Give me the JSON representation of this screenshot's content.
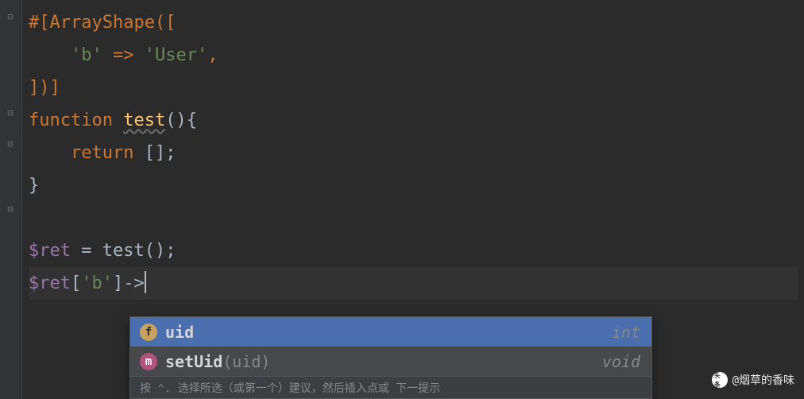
{
  "code": {
    "line1_attr": "#[",
    "line1_name": "ArrayShape",
    "line1_rest": "([",
    "line2_indent": "    ",
    "line2_key": "'b'",
    "line2_arrow": " => ",
    "line2_val": "'User'",
    "line2_comma": ",",
    "line3": "])]",
    "line4_fn": "function ",
    "line4_name": "test",
    "line4_rest": "(){",
    "line5_indent": "    ",
    "line5_return": "return ",
    "line5_arr": "[]",
    "line5_semi": ";",
    "line6": "}",
    "line7": "",
    "line8_var": "$ret",
    "line8_eq": " = ",
    "line8_call": "test()",
    "line8_semi": ";",
    "line9_var": "$ret",
    "line9_bracket_open": "[",
    "line9_key": "'b'",
    "line9_bracket_close": "]",
    "line9_arrow": "->"
  },
  "completion": {
    "items": [
      {
        "icon_letter": "f",
        "name": "uid",
        "params": "",
        "type": "int"
      },
      {
        "icon_letter": "m",
        "name": "setUid",
        "params": "(uid)",
        "type": "void"
      }
    ],
    "hint_text": "按 ⌃. 选择所选（或第一个）建议，然后插入点或 下一提示"
  },
  "watermark": {
    "text": "@烟草的香味"
  }
}
